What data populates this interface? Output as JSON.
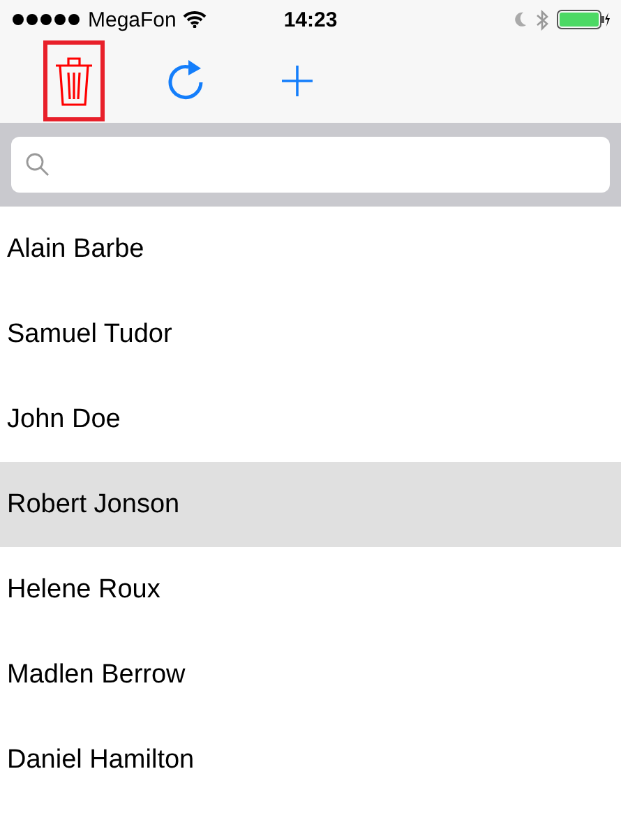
{
  "status_bar": {
    "carrier": "MegaFon",
    "time": "14:23"
  },
  "toolbar": [
    {
      "kind": "trash",
      "highlighted": true
    },
    {
      "kind": "refresh",
      "highlighted": false
    },
    {
      "kind": "add",
      "highlighted": false
    }
  ],
  "rows": [
    {
      "label": "Alain Barbe",
      "selected": false
    },
    {
      "label": "Samuel Tudor",
      "selected": false
    },
    {
      "label": "John Doe",
      "selected": false
    },
    {
      "label": "Robert Jonson",
      "selected": true
    },
    {
      "label": "Helene Roux",
      "selected": false
    },
    {
      "label": "Madlen Berrow",
      "selected": false
    },
    {
      "label": "Daniel Hamilton",
      "selected": false
    }
  ]
}
